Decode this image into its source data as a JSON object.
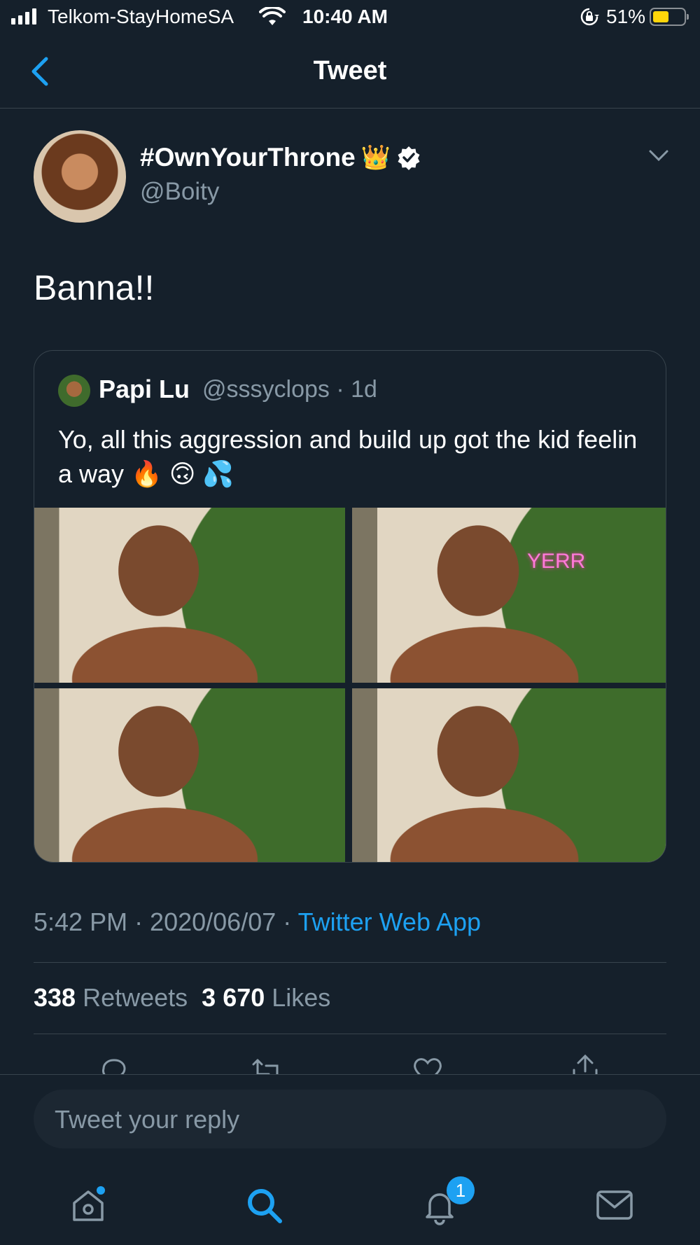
{
  "status_bar": {
    "carrier": "Telkom-StayHomeSA",
    "time": "10:40 AM",
    "battery_percent": "51%",
    "battery_level": 0.51,
    "icons": [
      "signal-icon",
      "wifi-icon",
      "rotation-lock-icon",
      "battery-icon"
    ]
  },
  "header": {
    "title": "Tweet",
    "back_icon": "chevron-left-icon"
  },
  "tweet": {
    "author_name": "#OwnYourThrone",
    "author_emoji": "👑",
    "handle": "@Boity",
    "text": "Banna!!",
    "timestamp": "5:42 PM · 2020/06/07 · ",
    "source": "Twitter Web App",
    "retweets_count": "338",
    "retweets_label": " Retweets",
    "likes_count": "3 670",
    "likes_label": " Likes"
  },
  "quoted_tweet": {
    "name": "Papi Lu",
    "meta": "@sssyclops · 1d",
    "text": "Yo, all this aggression and build up got the kid feelin a way 🔥 🙃 💦",
    "photo_overlay_text": "YERR",
    "photos": [
      "photo-1",
      "photo-2",
      "photo-3",
      "photo-4"
    ]
  },
  "reply_box": {
    "placeholder": "Tweet your reply"
  },
  "tab_bar": {
    "items": [
      "home-icon",
      "search-icon",
      "notifications-icon",
      "messages-icon"
    ],
    "notification_badge": "1"
  },
  "colors": {
    "background": "#15202b",
    "accent": "#1da1f2",
    "secondary_text": "#8899a6",
    "divider": "#38444d"
  }
}
